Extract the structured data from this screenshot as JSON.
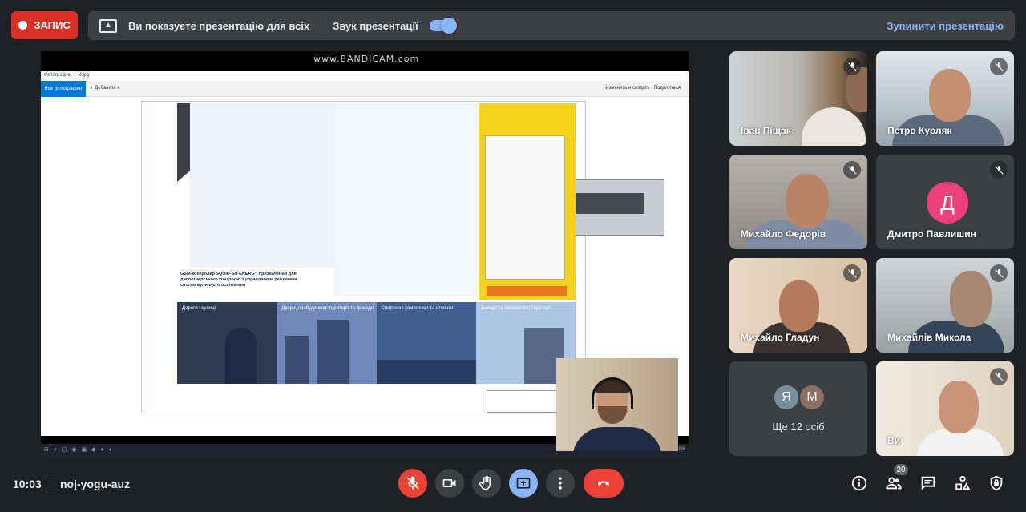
{
  "record_label": "ЗАПИС",
  "presentation_bar": {
    "message": "Ви показуєте презентацію для всіх",
    "sound_label": "Звук презентації",
    "sound_enabled": true,
    "stop_label": "Зупинити презентацію"
  },
  "shared_screen": {
    "watermark": "www.BANDICAM.com",
    "app_title": "Фотографии — 4.jpg",
    "app_tab": "Все фотографии",
    "app_add": "+ Добавить к",
    "app_actions": "Изменить и создать  ·  Поделиться",
    "doc_heading": "GSM-контролер SQUID-SH-ENERGY призначений для диспетчерського контролю з управлінням режимами систем вуличного освітлення",
    "scenes": [
      "Дороги і вулиці",
      "Двори, прибудинкові території та фасади",
      "Спортивні комплекси та стоянки",
      "Заводи та промислові території"
    ]
  },
  "participants": [
    {
      "name": "Іван Піщак",
      "muted": true
    },
    {
      "name": "Петро Курляк",
      "muted": true
    },
    {
      "name": "Михайло Федорів",
      "muted": true
    },
    {
      "name": "Дмитро Павлишин",
      "muted": true,
      "avatar_letter": "Д",
      "avatar_color": "#ec407a"
    },
    {
      "name": "Михайло Гладун",
      "muted": true
    },
    {
      "name": "Михайлів Микола",
      "muted": true
    },
    {
      "name": "Ви",
      "muted": true
    }
  ],
  "more_tile": {
    "label": "Ще 12 осіб",
    "avatars": [
      {
        "letter": "Я",
        "color": "#78909c"
      },
      {
        "letter": "М",
        "color": "#8d6e63"
      }
    ]
  },
  "footer": {
    "time": "10:03",
    "meeting_code": "noj-yogu-auz",
    "people_count": "20"
  },
  "icons": {
    "mic": "mic-off-icon",
    "camera": "videocam-icon",
    "hand": "raise-hand-icon",
    "present": "present-icon",
    "more": "more-vert-icon",
    "end": "call-end-icon",
    "info": "info-icon",
    "people": "people-icon",
    "chat": "chat-icon",
    "activities": "activities-icon",
    "lock": "lock-icon"
  },
  "colors": {
    "record": "#d93025",
    "accent": "#8ab4f8",
    "end_call": "#ea4335",
    "background": "#202124",
    "surface": "#3c4043"
  }
}
